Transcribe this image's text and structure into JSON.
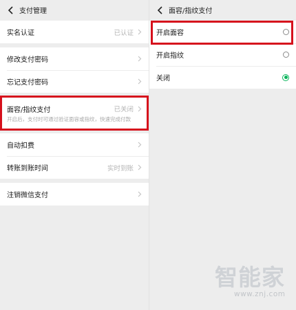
{
  "left": {
    "nav": {
      "title": "支付管理"
    },
    "groups": [
      {
        "items": [
          {
            "label": "实名认证",
            "value": "已认证"
          }
        ]
      },
      {
        "items": [
          {
            "label": "修改支付密码",
            "value": ""
          },
          {
            "label": "忘记支付密码",
            "value": ""
          }
        ]
      },
      {
        "items": [
          {
            "label": "面容/指纹支付",
            "value": "已关闭",
            "desc": "开启后，支付时可通过验证面容或指纹，快速完成付款"
          }
        ]
      },
      {
        "items": [
          {
            "label": "自动扣费",
            "value": ""
          },
          {
            "label": "转账到账时间",
            "value": "实时到账"
          }
        ]
      },
      {
        "items": [
          {
            "label": "注销微信支付",
            "value": ""
          }
        ]
      }
    ]
  },
  "right": {
    "nav": {
      "title": "面容/指纹支付"
    },
    "options": [
      {
        "label": "开启面容",
        "selected": false
      },
      {
        "label": "开启指纹",
        "selected": false
      },
      {
        "label": "关闭",
        "selected": true
      }
    ]
  },
  "watermark": {
    "logo": "智能家",
    "url": "www.znj.com"
  },
  "colors": {
    "highlight": "#d6101c",
    "accent": "#08b45a",
    "background": "#ededed"
  }
}
